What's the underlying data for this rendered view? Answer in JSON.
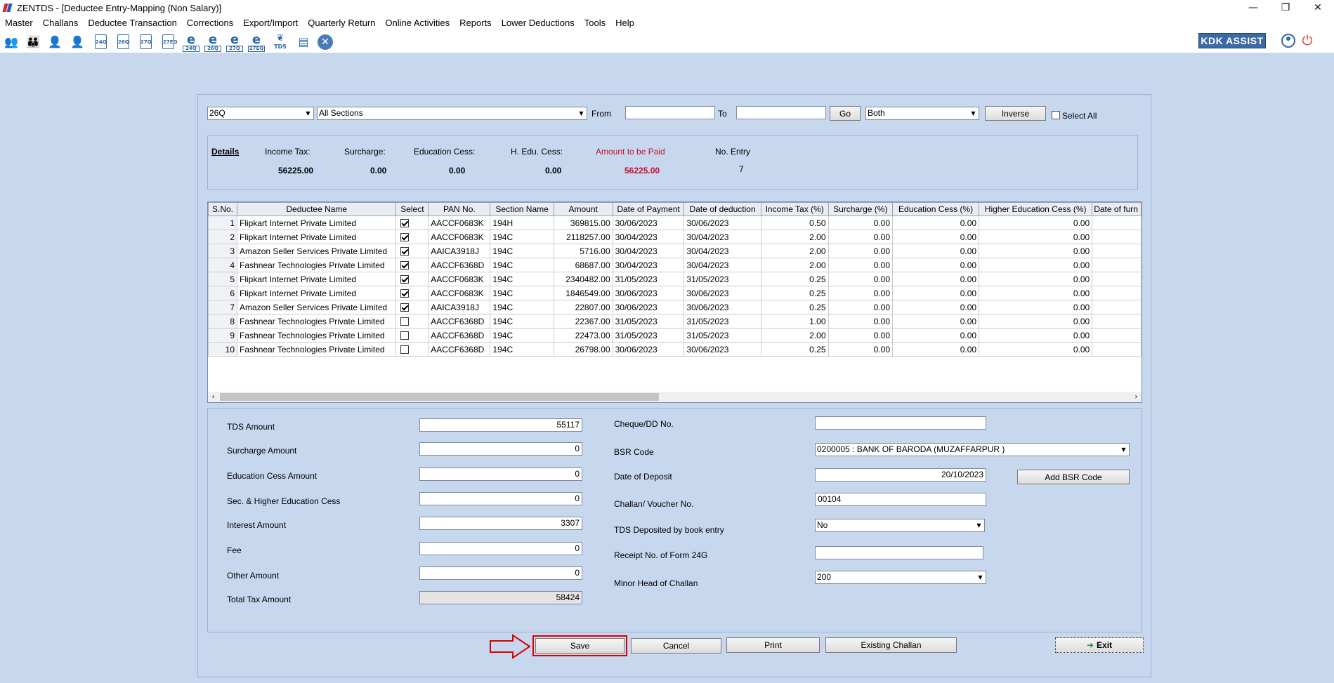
{
  "window": {
    "title": "ZENTDS - [Deductee Entry-Mapping (Non Salary)]",
    "controls": {
      "minimize": "—",
      "restore": "❐",
      "close": "✕"
    }
  },
  "menu": [
    "Master",
    "Challans",
    "Deductee Transaction",
    "Corrections",
    "Export/Import",
    "Quarterly Return",
    "Online Activities",
    "Reports",
    "Lower Deductions",
    "Tools",
    "Help"
  ],
  "toolbar": {
    "brand": "KDK ASSIST",
    "icon_labels": {
      "i5": "24Q",
      "i6": "26Q",
      "i7": "27Q",
      "i8": "27EQ",
      "i9": "24Q",
      "i10": "26Q",
      "i11": "27Q",
      "i12": "27EQ",
      "i13": "TDS"
    }
  },
  "filters": {
    "form_type": "26Q",
    "section": "All Sections",
    "from_label": "From",
    "from_value": "",
    "to_label": "To",
    "to_value": "",
    "go_label": "Go",
    "mode": "Both",
    "inverse_label": "Inverse",
    "select_all_label": "Select All"
  },
  "details": {
    "title": "Details",
    "income_tax_label": "Income Tax:",
    "income_tax_value": "56225.00",
    "surcharge_label": "Surcharge:",
    "surcharge_value": "0.00",
    "edu_cess_label": "Education Cess:",
    "edu_cess_value": "0.00",
    "h_edu_cess_label": "H. Edu. Cess:",
    "h_edu_cess_value": "0.00",
    "amount_paid_label": "Amount to be Paid",
    "amount_paid_value": "56225.00",
    "no_entry_label": "No. Entry",
    "no_entry_value": "7"
  },
  "grid": {
    "columns": [
      "S.No.",
      "Deductee Name",
      "Select",
      "PAN No.",
      "Section Name",
      "Amount",
      "Date of Payment",
      "Date of deduction",
      "Income Tax (%)",
      "Surcharge (%)",
      "Education Cess (%)",
      "Higher Education Cess (%)",
      "Date of furn"
    ],
    "rows": [
      {
        "sno": "1",
        "name": "Flipkart Internet Private Limited",
        "selected": true,
        "pan": "AACCF0683K",
        "section": "194H",
        "amount": "369815.00",
        "date_payment": "30/06/2023",
        "date_deduction": "30/06/2023",
        "it": "0.50",
        "sur": "0.00",
        "edu": "0.00",
        "hedu": "0.00"
      },
      {
        "sno": "2",
        "name": "Flipkart Internet Private Limited",
        "selected": true,
        "pan": "AACCF0683K",
        "section": "194C",
        "amount": "2118257.00",
        "date_payment": "30/04/2023",
        "date_deduction": "30/04/2023",
        "it": "2.00",
        "sur": "0.00",
        "edu": "0.00",
        "hedu": "0.00"
      },
      {
        "sno": "3",
        "name": "Amazon Seller Services Private Limited",
        "selected": true,
        "pan": "AAICA3918J",
        "section": "194C",
        "amount": "5716.00",
        "date_payment": "30/04/2023",
        "date_deduction": "30/04/2023",
        "it": "2.00",
        "sur": "0.00",
        "edu": "0.00",
        "hedu": "0.00"
      },
      {
        "sno": "4",
        "name": "Fashnear Technologies Private Limited",
        "selected": true,
        "pan": "AACCF6368D",
        "section": "194C",
        "amount": "68687.00",
        "date_payment": "30/04/2023",
        "date_deduction": "30/04/2023",
        "it": "2.00",
        "sur": "0.00",
        "edu": "0.00",
        "hedu": "0.00"
      },
      {
        "sno": "5",
        "name": "Flipkart Internet Private Limited",
        "selected": true,
        "pan": "AACCF0683K",
        "section": "194C",
        "amount": "2340482.00",
        "date_payment": "31/05/2023",
        "date_deduction": "31/05/2023",
        "it": "0.25",
        "sur": "0.00",
        "edu": "0.00",
        "hedu": "0.00"
      },
      {
        "sno": "6",
        "name": "Flipkart Internet Private Limited",
        "selected": true,
        "pan": "AACCF0683K",
        "section": "194C",
        "amount": "1846549.00",
        "date_payment": "30/06/2023",
        "date_deduction": "30/06/2023",
        "it": "0.25",
        "sur": "0.00",
        "edu": "0.00",
        "hedu": "0.00"
      },
      {
        "sno": "7",
        "name": "Amazon Seller Services Private Limited",
        "selected": true,
        "pan": "AAICA3918J",
        "section": "194C",
        "amount": "22807.00",
        "date_payment": "30/06/2023",
        "date_deduction": "30/06/2023",
        "it": "0.25",
        "sur": "0.00",
        "edu": "0.00",
        "hedu": "0.00"
      },
      {
        "sno": "8",
        "name": "Fashnear Technologies Private Limited",
        "selected": false,
        "pan": "AACCF6368D",
        "section": "194C",
        "amount": "22367.00",
        "date_payment": "31/05/2023",
        "date_deduction": "31/05/2023",
        "it": "1.00",
        "sur": "0.00",
        "edu": "0.00",
        "hedu": "0.00"
      },
      {
        "sno": "9",
        "name": "Fashnear Technologies Private Limited",
        "selected": false,
        "pan": "AACCF6368D",
        "section": "194C",
        "amount": "22473.00",
        "date_payment": "31/05/2023",
        "date_deduction": "31/05/2023",
        "it": "2.00",
        "sur": "0.00",
        "edu": "0.00",
        "hedu": "0.00"
      },
      {
        "sno": "10",
        "name": "Fashnear Technologies Private Limited",
        "selected": false,
        "pan": "AACCF6368D",
        "section": "194C",
        "amount": "26798.00",
        "date_payment": "30/06/2023",
        "date_deduction": "30/06/2023",
        "it": "0.25",
        "sur": "0.00",
        "edu": "0.00",
        "hedu": "0.00"
      }
    ]
  },
  "challan": {
    "tds_amount_label": "TDS Amount",
    "tds_amount": "55117",
    "surcharge_amount_label": "Surcharge Amount",
    "surcharge_amount": "0",
    "edu_cess_amount_label": "Education Cess Amount",
    "edu_cess_amount": "0",
    "sec_higher_cess_label": "Sec. & Higher Education Cess",
    "sec_higher_cess": "0",
    "interest_amount_label": "Interest Amount",
    "interest_amount": "3307",
    "fee_label": "Fee",
    "fee": "0",
    "other_amount_label": "Other Amount",
    "other_amount": "0",
    "total_tax_label": "Total Tax Amount",
    "total_tax": "58424",
    "cheque_label": "Cheque/DD No.",
    "cheque": "",
    "bsr_code_label": "BSR Code",
    "bsr_code": "0200005 : BANK OF BARODA (MUZAFFARPUR )",
    "date_deposit_label": "Date of Deposit",
    "date_deposit": "20/10/2023",
    "add_bsr_label": "Add BSR Code",
    "challan_no_label": "Challan/ Voucher No.",
    "challan_no": "00104",
    "book_entry_label": "TDS Deposited by book entry",
    "book_entry": "No",
    "receipt_24g_label": "Receipt No. of Form 24G",
    "receipt_24g": "",
    "minor_head_label": "Minor Head of Challan",
    "minor_head": "200"
  },
  "actions": {
    "save": "Save",
    "cancel": "Cancel",
    "print": "Print",
    "existing": "Existing Challan",
    "exit": "Exit"
  },
  "colors": {
    "background": "#c6d7ee",
    "accent_red": "#d90000",
    "amount_red": "#c8102e"
  }
}
